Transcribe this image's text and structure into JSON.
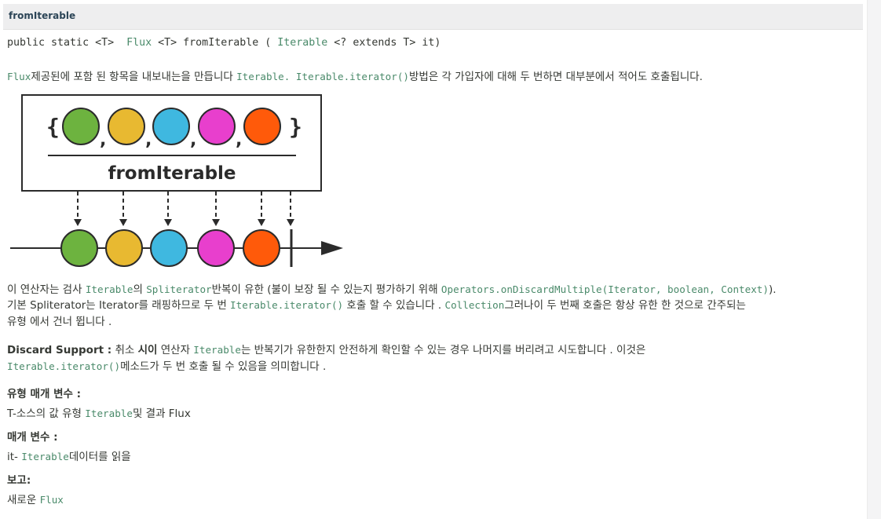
{
  "header": {
    "title": "fromIterable"
  },
  "signature": {
    "prefix": "public static <T>  ",
    "return_type": "Flux",
    "middle": " <T> fromIterable ( ",
    "param_type": "Iterable",
    "suffix": " <? extends T> it)"
  },
  "description": {
    "flux": "Flux",
    "text1": "제공된에 포함 된 항목을 내보내는을 만듭니다 ",
    "iterable": "Iterable",
    "dot": ". ",
    "iterator_call": "Iterable.iterator()",
    "text2": "방법은 각 가입자에 대해 두 번하면 대부분에서 적어도 호출됩니다."
  },
  "diagram": {
    "brace_open": "{",
    "brace_close": "}",
    "comma": ",",
    "operator_label": "fromIterable",
    "colors": [
      "#6db33f",
      "#e8b931",
      "#3fb8e0",
      "#e83fcd",
      "#ff5a0a"
    ]
  },
  "para1": {
    "l1_a": "이 연산자는 검사 ",
    "l1_iterable": "Iterable",
    "l1_b": "의 ",
    "l1_spliterator": "Spliterator",
    "l1_c": "반복이 유한 (불이 보장 될 수 있는지 평가하기 위해 ",
    "l1_ops": "Operators.onDiscardMultiple(Iterator, boolean, Context)",
    "l1_d": ").",
    "l2_a": "기본 Spliterator는 Iterator를 래핑하므로 두 번 ",
    "l2_iter": "Iterable.iterator()",
    "l2_b": " 호출 할 수 있습니다 . ",
    "l2_coll": "Collection",
    "l2_c": "그러나이 두 번째 호출은 항상 유한 한 것으로 간주되는",
    "l3": "유형 에서 건너 뜁니다 ."
  },
  "discard": {
    "label": "Discard Support :",
    "a": " 취소 ",
    "si": "시이",
    "b": " 연산자 ",
    "iterable": "Iterable",
    "c": "는 반복기가 유한한지 안전하게 확인할 수 있는 경우 나머지를 버리려고 시도합니다 . 이것은",
    "l2_iter": "Iterable.iterator()",
    "l2_b": "메소드가 두 번 호출 될 수 있음을 의미합니다 ."
  },
  "type_params": {
    "label": "유형 매개 변수 :",
    "a": "T-소스의 값 유형 ",
    "iterable": "Iterable",
    "b": "및 결과 Flux"
  },
  "params": {
    "label": "매개 변수 :",
    "a": "it- ",
    "iterable": "Iterable",
    "b": "데이터를 읽을"
  },
  "returns": {
    "label": "보고:",
    "a": "새로운 ",
    "flux": "Flux"
  }
}
